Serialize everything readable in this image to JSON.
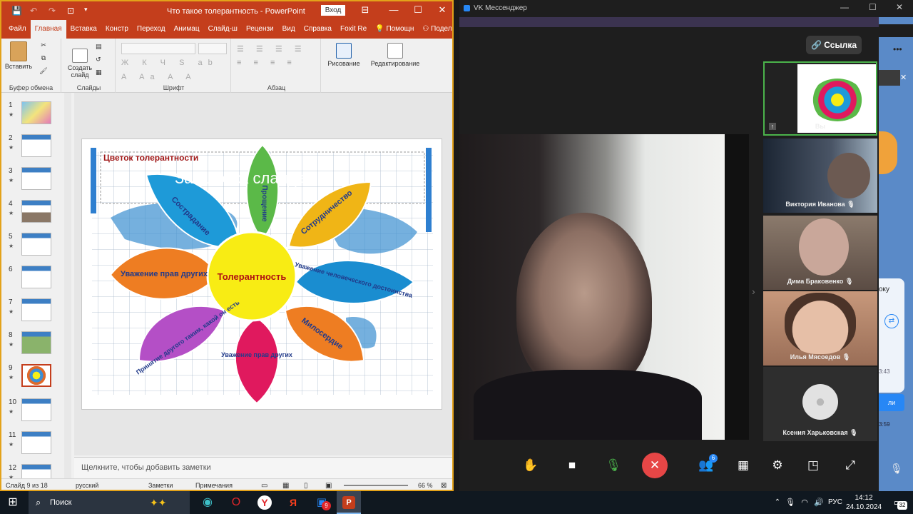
{
  "ppt": {
    "doc_title": "Что такое толерантность  -  PowerPoint",
    "signin": "Вход",
    "tabs": [
      "Файл",
      "Главная",
      "Вставка",
      "Констр",
      "Переход",
      "Анимац",
      "Слайд-ш",
      "Рецензи",
      "Вид",
      "Справка",
      "Foxit Re",
      "Помощн",
      "Поделиться"
    ],
    "ribbon": {
      "paste": "Вставить",
      "clipboard": "Буфер обмена",
      "new_slide": "Создать\nслайд",
      "slides": "Слайды",
      "font": "Шрифт",
      "paragraph": "Абзац",
      "drawing": "Рисование",
      "editing": "Редактирование"
    },
    "thumbs": [
      "1",
      "2",
      "3",
      "4",
      "5",
      "6",
      "7",
      "8",
      "9",
      "10",
      "11",
      "12"
    ],
    "star": "★",
    "slide": {
      "heading": "Цветок  толерантности",
      "ghost_title": "Заголовок слайда",
      "center": "Толерантность",
      "petals": [
        "Сострадание",
        "Прощение",
        "Сотрудничество",
        "Уважение человеческого достоинства",
        "Милосердие",
        "Уважение прав других",
        "Принятие другого таким, какой он есть",
        "Уважение прав других"
      ]
    },
    "notes": "Щелкните, чтобы добавить заметки",
    "status": {
      "slide": "Слайд 9 из 18",
      "lang": "русский",
      "notes_btn": "Заметки",
      "comments_btn": "Примечания",
      "zoom": "66 %"
    }
  },
  "vk": {
    "title": "VK Мессенджер",
    "link_btn": "Ссылка",
    "self_label": "Вы",
    "participants": [
      "Виктория Иванова",
      "Дима Браковенко",
      "Илья Мясоедов",
      "Ксения Харьковская"
    ],
    "people_badge": "6",
    "side_snippets": [
      "оку",
      "3:43",
      "ли",
      "3:59"
    ]
  },
  "taskbar": {
    "search": "Поиск",
    "lang": "РУС",
    "time": "14:12",
    "date": "24.10.2024",
    "notif": "32",
    "browser_badge": "9"
  }
}
